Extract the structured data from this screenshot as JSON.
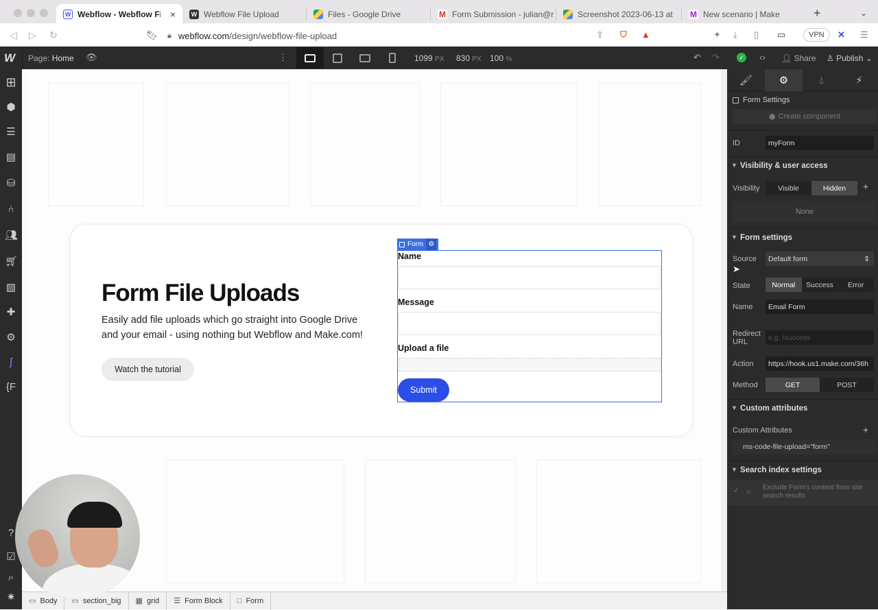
{
  "browser": {
    "tabs": [
      {
        "label": "Webflow - Webflow File",
        "icon": "webflow-icon",
        "active": true
      },
      {
        "label": "Webflow File Upload",
        "icon": "webflow-icon"
      },
      {
        "label": "Files - Google Drive",
        "icon": "google-drive-icon"
      },
      {
        "label": "Form Submission - julian@r",
        "icon": "gmail-icon"
      },
      {
        "label": "Screenshot 2023-06-13 at",
        "icon": "google-drive-icon"
      },
      {
        "label": "New scenario | Make",
        "icon": "make-icon"
      }
    ],
    "url_domain": "webflow.com",
    "url_path": "/design/webflow-file-upload",
    "vpn_label": "VPN"
  },
  "designer": {
    "page_label": "Page:",
    "page_name": "Home",
    "width": "1099",
    "width_unit": "PX",
    "height": "830",
    "height_unit": "PX",
    "zoom": "100",
    "zoom_unit": "%",
    "share_label": "Share",
    "publish_label": "Publish"
  },
  "canvas": {
    "hero_title": "Form File Uploads",
    "hero_text": "Easily add file uploads which go straight into Google Drive and your email - using nothing but Webflow and Make.com!",
    "tutorial_button": "Watch the tutorial",
    "form_tag": "Form",
    "name_label": "Name",
    "message_label": "Message",
    "upload_label": "Upload a file",
    "submit_label": "Submit"
  },
  "panel": {
    "element_label": "Form Settings",
    "create_component": "Create component",
    "id_label": "ID",
    "id_value": "myForm",
    "visibility_section": "Visibility & user access",
    "visibility_label": "Visibility",
    "visibility_options": [
      "Visible",
      "Hidden"
    ],
    "visibility_selected": "Hidden",
    "none_label": "None",
    "form_section": "Form settings",
    "source_label": "Source",
    "source_value": "Default form",
    "state_label": "State",
    "state_options": [
      "Normal",
      "Success",
      "Error"
    ],
    "state_selected": "Normal",
    "name_label": "Name",
    "name_value": "Email Form",
    "redirect_label": "Redirect URL",
    "redirect_placeholder": "e.g. /success",
    "action_label": "Action",
    "action_value": "https://hook.us1.make.com/36h",
    "method_label": "Method",
    "method_options": [
      "GET",
      "POST"
    ],
    "method_selected": "GET",
    "custom_section": "Custom attributes",
    "custom_label": "Custom Attributes",
    "custom_attr": "ms-code-file-upload=\"form\"",
    "search_section": "Search index settings",
    "search_exclude": "Exclude Form's content from site search results"
  },
  "breadcrumbs": [
    {
      "label": "Body",
      "icon": "body-icon"
    },
    {
      "label": "section_big",
      "icon": "section-icon"
    },
    {
      "label": "grid",
      "icon": "grid-icon"
    },
    {
      "label": "Form Block",
      "icon": "form-block-icon"
    },
    {
      "label": "Form",
      "icon": "form-icon"
    }
  ]
}
